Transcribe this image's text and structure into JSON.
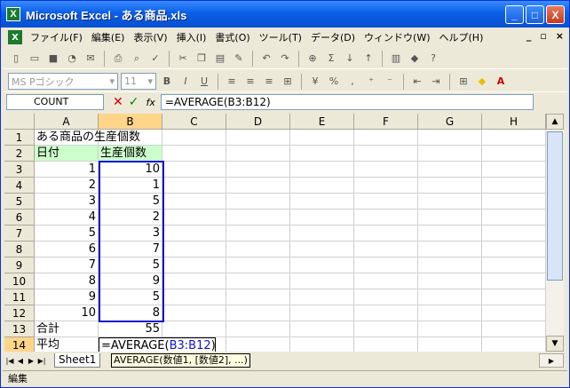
{
  "window": {
    "title": "Microsoft Excel - ある商品.xls",
    "app_icon": "X"
  },
  "window_buttons": {
    "minimize": "_",
    "maximize": "□",
    "close": "X"
  },
  "menu": [
    "ファイル(F)",
    "編集(E)",
    "表示(V)",
    "挿入(I)",
    "書式(O)",
    "ツール(T)",
    "データ(D)",
    "ウィンドウ(W)",
    "ヘルプ(H)"
  ],
  "mdi_controls": {
    "minimize": "_",
    "restore": "▫",
    "close": "×"
  },
  "toolbar2": {
    "font_name": "MS Pゴシック",
    "font_size": "11",
    "percent": "%",
    "comma": ",",
    "bold": "B",
    "italic": "I",
    "underline": "U"
  },
  "formula_bar": {
    "name_box": "COUNT",
    "cancel": "✕",
    "enter": "✓",
    "fx": "fx",
    "formula": "=AVERAGE(B3:B12)"
  },
  "columns": [
    "A",
    "B",
    "C",
    "D",
    "E",
    "F",
    "G",
    "H"
  ],
  "rows": [
    "1",
    "2",
    "3",
    "4",
    "5",
    "6",
    "7",
    "8",
    "9",
    "10",
    "11",
    "12",
    "13",
    "14"
  ],
  "cells": {
    "title": "ある商品の生産個数",
    "header_date": "日付",
    "header_qty": "生産個数",
    "dates": [
      "1",
      "2",
      "3",
      "4",
      "5",
      "6",
      "7",
      "8",
      "9",
      "10"
    ],
    "quantities": [
      "10",
      "1",
      "5",
      "2",
      "3",
      "7",
      "5",
      "9",
      "5",
      "8"
    ],
    "total_label": "合計",
    "total_value": "55",
    "avg_label": "平均"
  },
  "editing": {
    "prefix": "=AVERAGE(",
    "ref": "B3:B12",
    "suffix": ")"
  },
  "tooltip": {
    "text": "AVERAGE(数値1, [数値2], ...)"
  },
  "sheet_tabs": [
    "Sheet1"
  ],
  "status_text": "編集",
  "colors": {
    "title_blue": "#0A5FE8",
    "header_fill": "#CCFFCC",
    "range_border": "#1111CC",
    "selected_header": "#FFD58A"
  }
}
